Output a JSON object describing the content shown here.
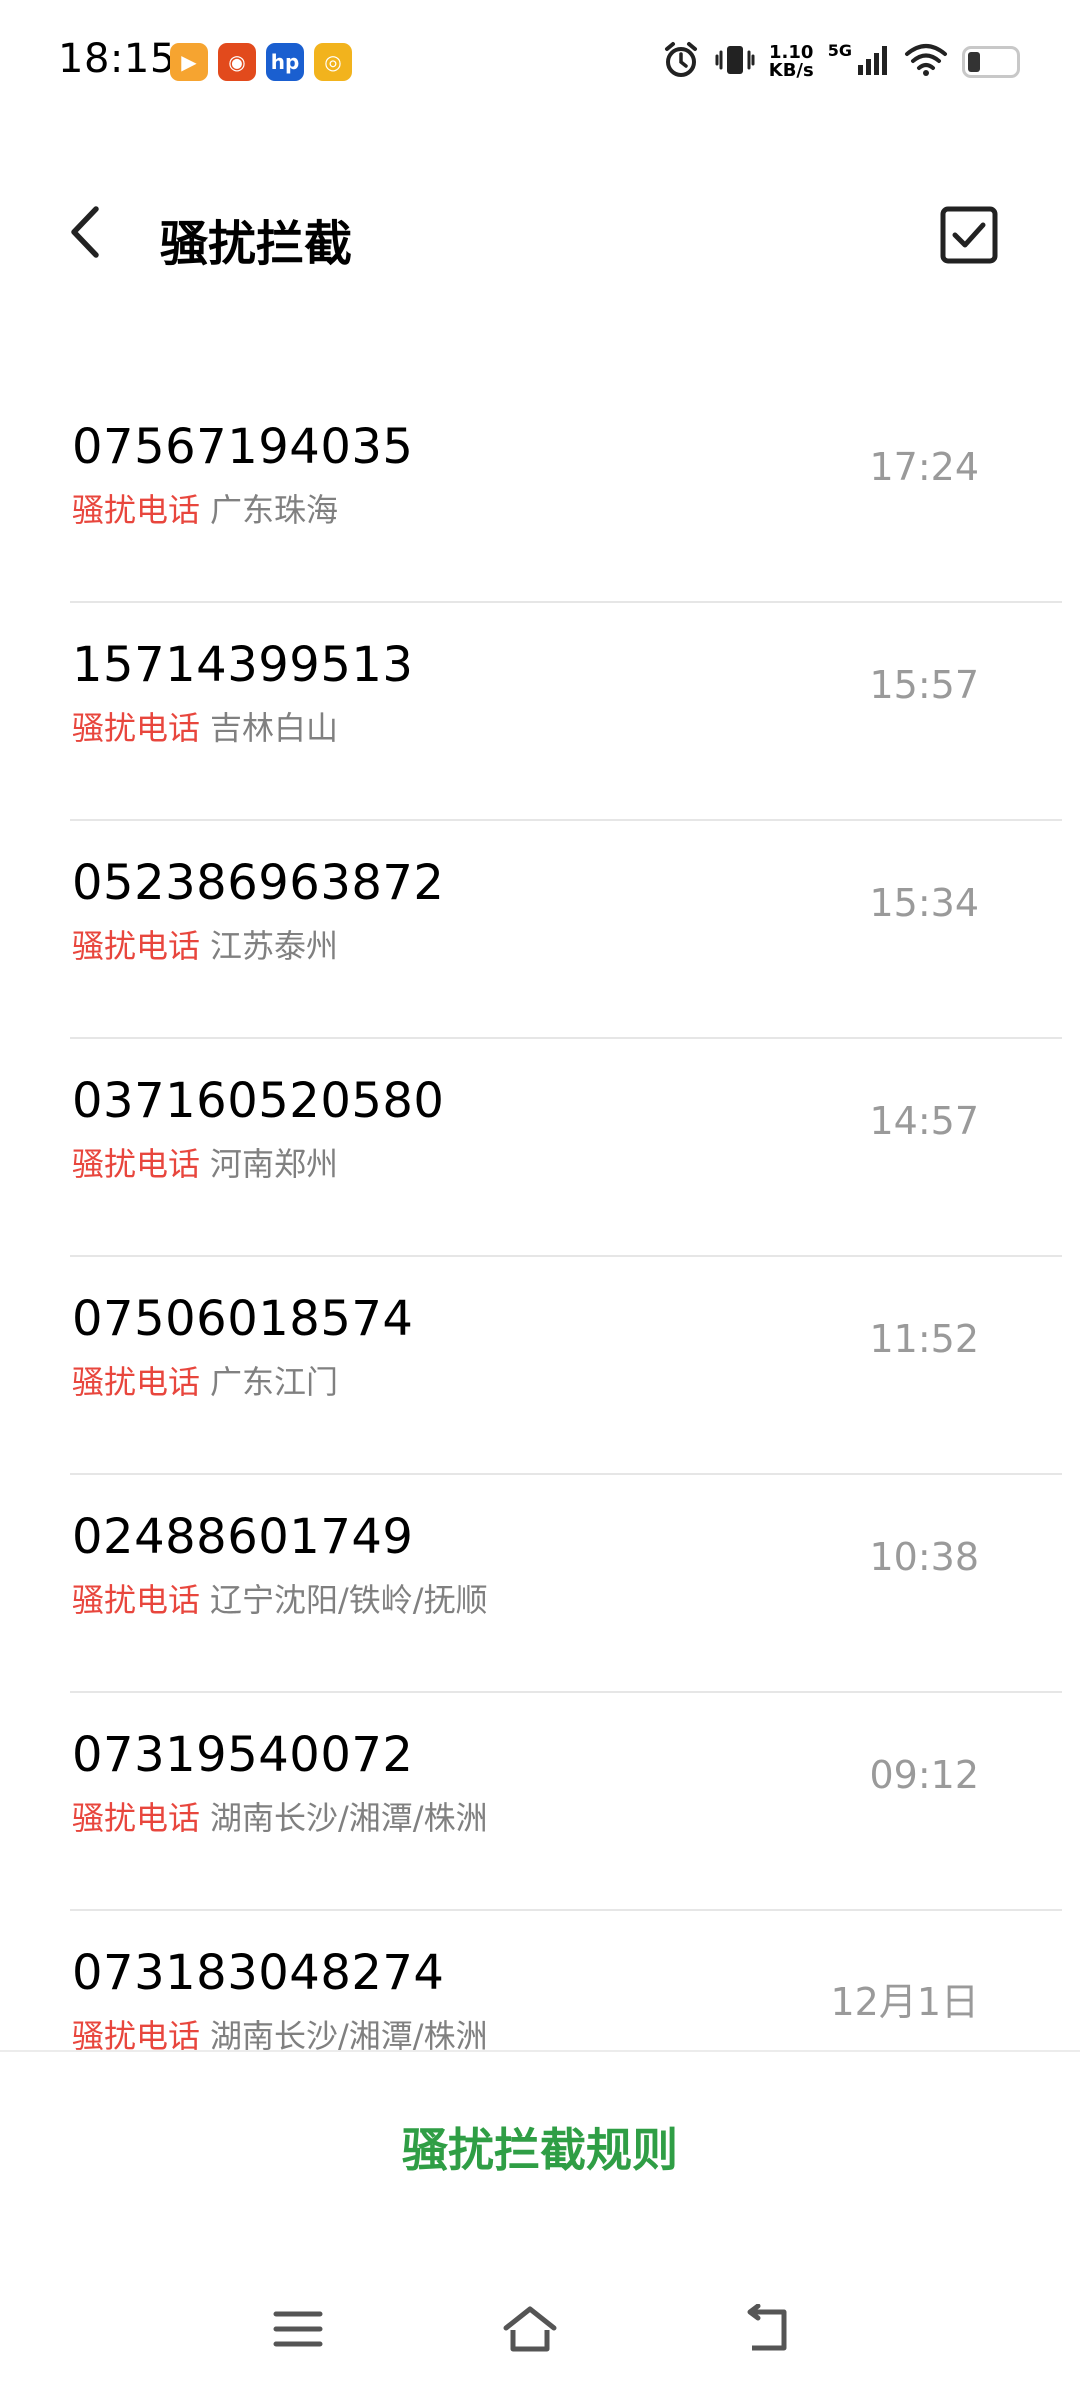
{
  "status_bar": {
    "time": "18:15",
    "net_speed_value": "1.10",
    "net_speed_unit": "KB/s",
    "network_type": "5G",
    "app_icons": [
      {
        "name": "video-app-icon",
        "color": "#f6a430",
        "glyph": "▶"
      },
      {
        "name": "taobao-app-icon",
        "color": "#e24a1c",
        "glyph": "◉"
      },
      {
        "name": "hp-app-icon",
        "color": "#1a5fd0",
        "glyph": "hp"
      },
      {
        "name": "weibo-app-icon",
        "color": "#f2b31d",
        "glyph": "◎"
      }
    ]
  },
  "header": {
    "title": "骚扰拦截"
  },
  "calls": [
    {
      "number": "07567194035",
      "tag": "骚扰电话",
      "location": "广东珠海",
      "time": "17:24"
    },
    {
      "number": "15714399513",
      "tag": "骚扰电话",
      "location": "吉林白山",
      "time": "15:57"
    },
    {
      "number": "052386963872",
      "tag": "骚扰电话",
      "location": "江苏泰州",
      "time": "15:34"
    },
    {
      "number": "037160520580",
      "tag": "骚扰电话",
      "location": "河南郑州",
      "time": "14:57"
    },
    {
      "number": "07506018574",
      "tag": "骚扰电话",
      "location": "广东江门",
      "time": "11:52"
    },
    {
      "number": "02488601749",
      "tag": "骚扰电话",
      "location": "辽宁沈阳/铁岭/抚顺",
      "time": "10:38"
    },
    {
      "number": "07319540072",
      "tag": "骚扰电话",
      "location": "湖南长沙/湘潭/株洲",
      "time": "09:12"
    },
    {
      "number": "073183048274",
      "tag": "骚扰电话",
      "location": "湖南长沙/湘潭/株洲",
      "time": "12月1日"
    }
  ],
  "bottom": {
    "rules_label": "骚扰拦截规则"
  },
  "colors": {
    "tag": "#e8463d",
    "accent": "#2f9e45",
    "secondary_text": "#808080"
  }
}
